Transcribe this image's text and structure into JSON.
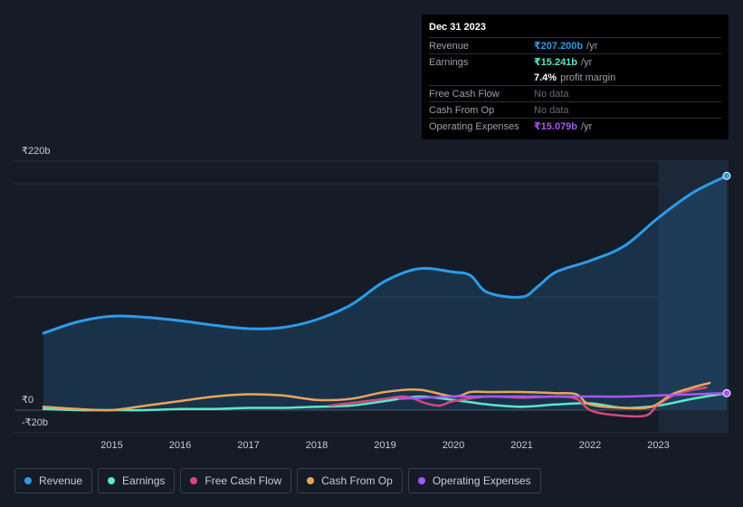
{
  "tooltip": {
    "date": "Dec 31 2023",
    "rows": [
      {
        "label": "Revenue",
        "value": "₹207.200b",
        "unit": "/yr",
        "color": "#2d9be8"
      },
      {
        "label": "Earnings",
        "value": "₹15.241b",
        "unit": "/yr",
        "color": "#5ee6c8"
      },
      {
        "label": "",
        "value": "7.4%",
        "unit": "profit margin",
        "color": "#ffffff"
      },
      {
        "label": "Free Cash Flow",
        "value": "No data",
        "unit": "",
        "color": "#646a73"
      },
      {
        "label": "Cash From Op",
        "value": "No data",
        "unit": "",
        "color": "#646a73"
      },
      {
        "label": "Operating Expenses",
        "value": "₹15.079b",
        "unit": "/yr",
        "color": "#a855f7"
      }
    ]
  },
  "legend": [
    {
      "label": "Revenue",
      "color": "#2d9be8"
    },
    {
      "label": "Earnings",
      "color": "#5ee6c8"
    },
    {
      "label": "Free Cash Flow",
      "color": "#d6487e"
    },
    {
      "label": "Cash From Op",
      "color": "#e8a55a"
    },
    {
      "label": "Operating Expenses",
      "color": "#a855f7"
    }
  ],
  "chart_data": {
    "type": "line",
    "y_tick_labels": [
      "₹220b",
      "₹0",
      "-₹20b"
    ],
    "x_tick_labels": [
      "2015",
      "2016",
      "2017",
      "2018",
      "2019",
      "2020",
      "2021",
      "2022",
      "2023"
    ],
    "ylim": [
      -20,
      220
    ],
    "xlim": [
      2014.0,
      2024.0
    ],
    "x_ticks": [
      2015,
      2016,
      2017,
      2018,
      2019,
      2020,
      2021,
      2022,
      2023
    ],
    "highlight_start": 2023.0,
    "grid": true,
    "series": [
      {
        "name": "Revenue",
        "color": "#2d9be8",
        "fill": true,
        "x": [
          2014.0,
          2014.5,
          2015.0,
          2015.5,
          2016.0,
          2016.5,
          2017.0,
          2017.5,
          2018.0,
          2018.5,
          2019.0,
          2019.5,
          2020.0,
          2020.25,
          2020.5,
          2021.0,
          2021.25,
          2021.5,
          2022.0,
          2022.5,
          2023.0,
          2023.5,
          2024.0
        ],
        "y": [
          68,
          78,
          83,
          82,
          79,
          75,
          72,
          73,
          80,
          93,
          114,
          125,
          122,
          119,
          104,
          100,
          110,
          122,
          132,
          145,
          170,
          192,
          207
        ]
      },
      {
        "name": "Earnings",
        "color": "#5ee6c8",
        "fill": false,
        "x": [
          2014.0,
          2014.5,
          2015.0,
          2015.5,
          2016.0,
          2016.5,
          2017.0,
          2017.5,
          2018.0,
          2018.5,
          2019.0,
          2019.5,
          2020.0,
          2020.5,
          2021.0,
          2021.5,
          2022.0,
          2022.5,
          2023.0,
          2023.5,
          2024.0
        ],
        "y": [
          1,
          0,
          0,
          0,
          1,
          1,
          2,
          2,
          3,
          4,
          8,
          12,
          9,
          5,
          3,
          5,
          6,
          2,
          4,
          10,
          15
        ]
      },
      {
        "name": "Free Cash Flow",
        "color": "#d6487e",
        "fill": false,
        "x": [
          2018.2,
          2018.6,
          2019.0,
          2019.3,
          2019.6,
          2019.8,
          2020.0,
          2020.5,
          2021.0,
          2021.5,
          2021.8,
          2022.0,
          2022.3,
          2022.8,
          2023.0,
          2023.3,
          2023.7
        ],
        "y": [
          4,
          7,
          10,
          12,
          6,
          4,
          8,
          12,
          11,
          12,
          10,
          0,
          -4,
          -5,
          5,
          15,
          20
        ]
      },
      {
        "name": "Cash From Op",
        "color": "#e8a55a",
        "fill": false,
        "x": [
          2014.0,
          2014.5,
          2015.0,
          2015.5,
          2016.0,
          2016.5,
          2017.0,
          2017.5,
          2018.0,
          2018.5,
          2019.0,
          2019.5,
          2020.0,
          2020.25,
          2020.5,
          2021.0,
          2021.5,
          2021.8,
          2022.0,
          2022.5,
          2022.9,
          2023.2,
          2023.5,
          2023.75
        ],
        "y": [
          3,
          1,
          0,
          4,
          8,
          12,
          14,
          13,
          9,
          10,
          16,
          18,
          12,
          16,
          16,
          16,
          15,
          14,
          5,
          2,
          3,
          14,
          20,
          24
        ]
      },
      {
        "name": "Operating Expenses",
        "color": "#a855f7",
        "fill": false,
        "x": [
          2019.2,
          2019.6,
          2020.0,
          2020.5,
          2021.0,
          2021.5,
          2022.0,
          2022.5,
          2023.0,
          2023.5,
          2024.0
        ],
        "y": [
          10,
          11,
          12,
          12,
          12,
          12,
          12,
          12,
          13,
          14,
          15
        ]
      }
    ]
  }
}
